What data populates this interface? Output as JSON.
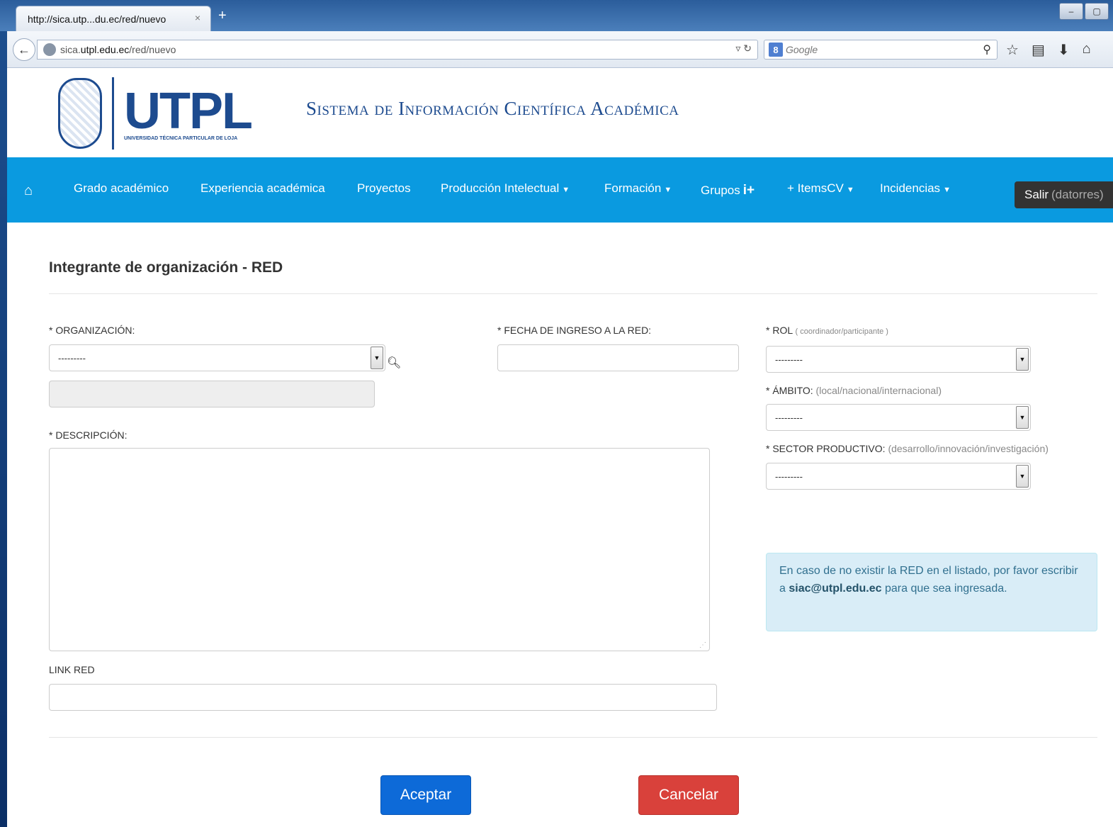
{
  "browser": {
    "tab_title": "http://sica.utp...du.ec/red/nuevo",
    "tab_close": "×",
    "new_tab": "+",
    "url_host": "sica.utpl.edu.ec",
    "url_path": "/red/nuevo",
    "url_prefix": "sica.",
    "url_domain": "utpl.edu.ec",
    "search_engine_badge": "8",
    "search_placeholder": "Google",
    "icons": [
      "back-arrow-icon",
      "globe-icon",
      "reload-icon",
      "search-icon",
      "star-icon",
      "clipboard-icon",
      "download-icon",
      "home-icon"
    ]
  },
  "header": {
    "brand_name": "UTPL",
    "brand_sub": "UNIVERSIDAD TÉCNICA PARTICULAR DE LOJA",
    "site_title": "Sistema de Información Científica Académica",
    "brand_color": "#1d4b8f"
  },
  "nav": {
    "bg_color": "#0a9ae0",
    "items": [
      {
        "label": "Grado académico"
      },
      {
        "label": "Experiencia académica"
      },
      {
        "label": "Proyectos"
      },
      {
        "label": "Producción Intelectual"
      },
      {
        "label": "Formación"
      },
      {
        "label": "Grupos"
      },
      {
        "label": "+ ItemsCV"
      },
      {
        "label": "Incidencias"
      }
    ],
    "grupos_badge": "i+",
    "logout_label": "Salir",
    "logout_user": "(datorres)"
  },
  "form": {
    "title": "Integrante de organización - RED",
    "organizacion_label": "* ORGANIZACIÓN:",
    "organizacion_value": "---------",
    "fecha_label": "* FECHA DE INGRESO A LA RED:",
    "fecha_value": "",
    "rol_label": "* ROL",
    "rol_hint": "( coordinador/participante )",
    "rol_value": "---------",
    "ambito_label": "* ÁMBITO:",
    "ambito_hint": "(local/nacional/internacional)",
    "ambito_value": "---------",
    "sector_label": "* SECTOR PRODUCTIVO:",
    "sector_hint": "(desarrollo/innovación/investigación)",
    "sector_value": "---------",
    "descripcion_label": "* DESCRIPCIÓN:",
    "descripcion_value": "",
    "link_label": "LINK RED",
    "link_value": ""
  },
  "alert": {
    "text_before": "En caso de no existir la RED en el listado, por favor escribir a ",
    "email": "siac@utpl.edu.ec",
    "text_after": " para que sea ingresada."
  },
  "actions": {
    "accept_label": "Aceptar",
    "cancel_label": "Cancelar",
    "accept_color": "#0d6ad8",
    "cancel_color": "#d9413b"
  }
}
